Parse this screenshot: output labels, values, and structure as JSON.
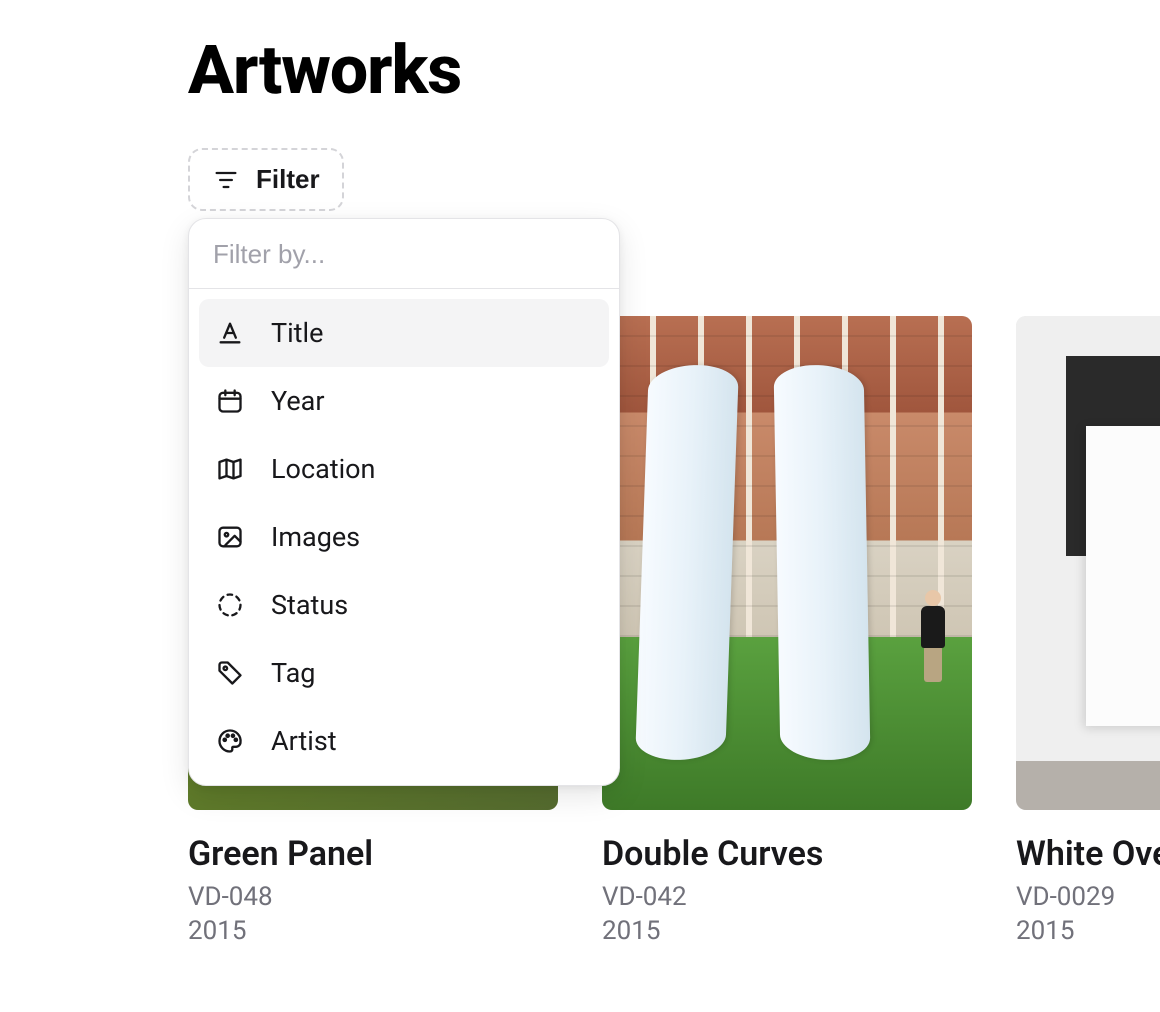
{
  "page": {
    "title": "Artworks"
  },
  "filter": {
    "button_label": "Filter",
    "search_placeholder": "Filter by...",
    "options": [
      {
        "label": "Title",
        "icon": "text-a-icon",
        "highlighted": true
      },
      {
        "label": "Year",
        "icon": "calendar-icon",
        "highlighted": false
      },
      {
        "label": "Location",
        "icon": "map-icon",
        "highlighted": false
      },
      {
        "label": "Images",
        "icon": "image-icon",
        "highlighted": false
      },
      {
        "label": "Status",
        "icon": "dashed-circle-icon",
        "highlighted": false
      },
      {
        "label": "Tag",
        "icon": "tag-icon",
        "highlighted": false
      },
      {
        "label": "Artist",
        "icon": "palette-icon",
        "highlighted": false
      }
    ]
  },
  "artworks": [
    {
      "title": "Green Panel",
      "code": "VD-048",
      "year": "2015"
    },
    {
      "title": "Double Curves",
      "code": "VD-042",
      "year": "2015"
    },
    {
      "title": "White Ove",
      "code": "VD-0029",
      "year": "2015"
    }
  ]
}
